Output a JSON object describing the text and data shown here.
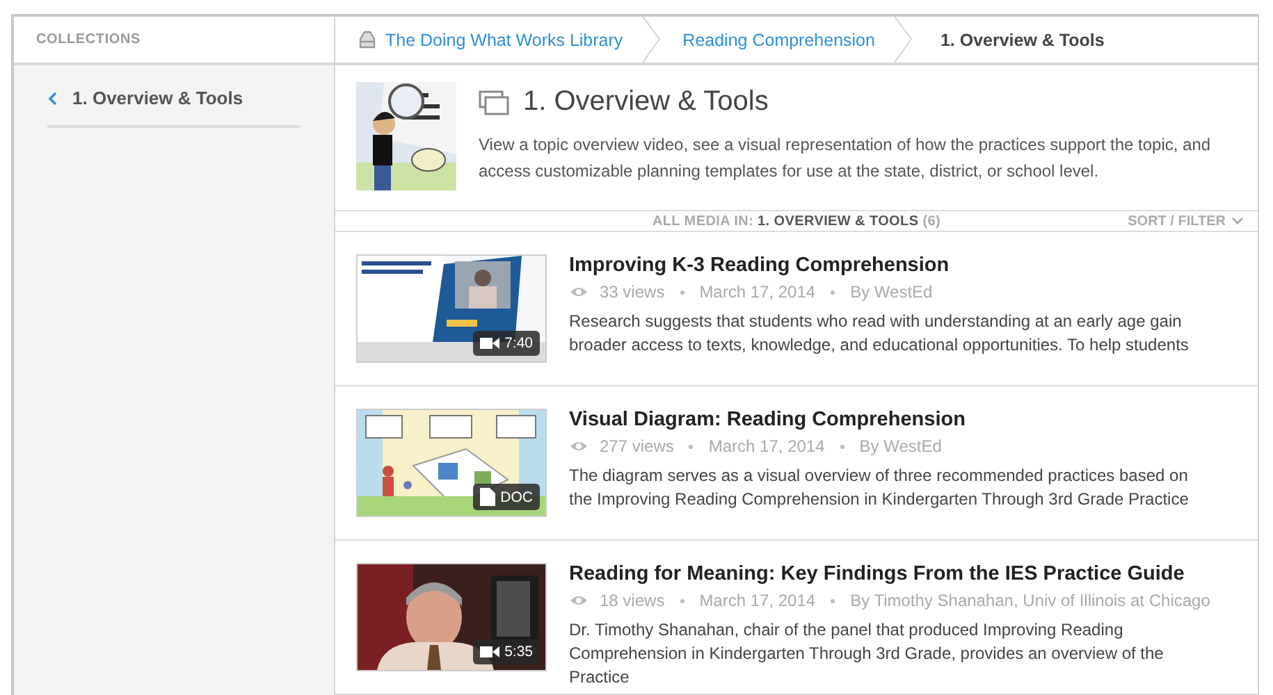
{
  "sidebar": {
    "heading": "COLLECTIONS",
    "items": [
      {
        "label": "1. Overview & Tools",
        "selected": true
      }
    ]
  },
  "breadcrumbs": [
    {
      "label": "The Doing What Works Library",
      "kind": "library"
    },
    {
      "label": "Reading Comprehension",
      "kind": "link"
    },
    {
      "label": "1. Overview & Tools",
      "kind": "current"
    }
  ],
  "topic": {
    "title": "1. Overview & Tools",
    "description": "View a topic overview video, see a visual representation of how the practices support the topic, and access customizable planning templates for use at the state, district, or school level."
  },
  "media_bar": {
    "label": "ALL MEDIA IN:",
    "collection": "1. OVERVIEW & TOOLS",
    "count": "(6)",
    "sort": "SORT / FILTER"
  },
  "items": [
    {
      "title": "Improving K-3 Reading Comprehension",
      "views": "33 views",
      "date": "March 17, 2014",
      "author": "By WestEd",
      "description": "Research suggests that students who read with understanding at an early age gain broader access to texts, knowledge, and educational opportunities. To help students",
      "badge": {
        "kind": "video",
        "text": "7:40"
      }
    },
    {
      "title": "Visual Diagram: Reading Comprehension",
      "views": "277 views",
      "date": "March 17, 2014",
      "author": "By WestEd",
      "description": "The diagram serves as a visual overview of three recommended practices based on the Improving Reading Comprehension in Kindergarten Through 3rd Grade Practice",
      "badge": {
        "kind": "doc",
        "text": "DOC"
      }
    },
    {
      "title": "Reading for Meaning: Key Findings From the IES Practice Guide",
      "views": "18 views",
      "date": "March 17, 2014",
      "author": "By Timothy Shanahan, Univ of Illinois at Chicago",
      "description": "Dr. Timothy Shanahan, chair of the panel that produced Improving Reading Comprehension in Kindergarten Through 3rd Grade, provides an overview of the Practice",
      "badge": {
        "kind": "video",
        "text": "5:35"
      }
    }
  ]
}
